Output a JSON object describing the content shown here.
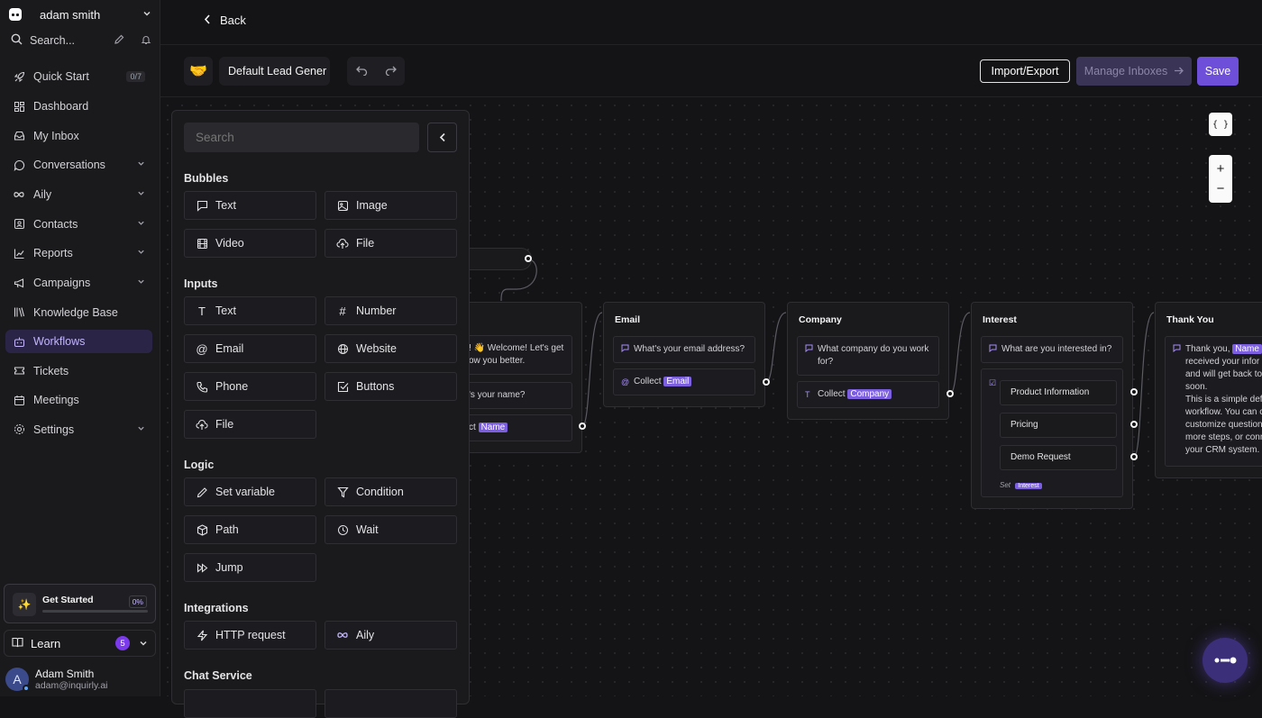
{
  "sidebar": {
    "workspace": "adam smith",
    "search_label": "Search...",
    "items": [
      {
        "label": "Quick Start",
        "badge": "0/7"
      },
      {
        "label": "Dashboard"
      },
      {
        "label": "My Inbox"
      },
      {
        "label": "Conversations"
      },
      {
        "label": "Aily"
      },
      {
        "label": "Contacts"
      },
      {
        "label": "Reports"
      },
      {
        "label": "Campaigns"
      },
      {
        "label": "Knowledge Base"
      },
      {
        "label": "Workflows"
      },
      {
        "label": "Tickets"
      },
      {
        "label": "Meetings"
      },
      {
        "label": "Settings"
      }
    ],
    "get_started": {
      "label": "Get Started",
      "progress": "0%"
    },
    "learn": {
      "label": "Learn",
      "count": "5"
    },
    "user": {
      "initial": "A",
      "name": "Adam Smith",
      "email": "adam@inquirly.ai"
    }
  },
  "topbar": {
    "back_label": "Back"
  },
  "toolbar": {
    "emoji": "🤝",
    "workflow_name": "Default Lead Gener",
    "import_export": "Import/Export",
    "manage_inboxes": "Manage Inboxes",
    "save": "Save"
  },
  "panel": {
    "search_placeholder": "Search",
    "sections": {
      "bubbles": "Bubbles",
      "inputs": "Inputs",
      "logic": "Logic",
      "integrations": "Integrations",
      "chat_service": "Chat Service"
    },
    "bubbles": [
      "Text",
      "Image",
      "Video",
      "File"
    ],
    "inputs": [
      "Text",
      "Number",
      "Email",
      "Website",
      "Phone",
      "Buttons",
      "File"
    ],
    "logic": [
      "Set variable",
      "Condition",
      "Path",
      "Wait",
      "Jump"
    ],
    "integrations": [
      "HTTP request",
      "Aily"
    ]
  },
  "canvas": {
    "controls": {
      "vars": "{ }",
      "zoom_in": "+",
      "zoom_out": "−"
    },
    "nodes": {
      "name": {
        "welcome": "! 👋 Welcome! Let's get",
        "welcome2": "ow you better.",
        "question": "'s your name?",
        "collect": "ct",
        "var": "Name"
      },
      "email": {
        "title": "Email",
        "question": "What's your email address?",
        "collect": "Collect",
        "var": "Email"
      },
      "company": {
        "title": "Company",
        "question": "What company do you work for?",
        "collect": "Collect",
        "var": "Company"
      },
      "interest": {
        "title": "Interest",
        "question": "What are you interested in?",
        "options": [
          "Product Information",
          "Pricing",
          "Demo Request"
        ],
        "set_label": "Set",
        "var": "Interest"
      },
      "thankyou": {
        "title": "Thank You",
        "lines": [
          "Thank you,",
          "received your infor",
          "and will get back to",
          "soon.",
          "This is a simple defa",
          "workflow. You can c",
          "customize question",
          "more steps, or conn",
          "your CRM system."
        ],
        "var": "Name"
      }
    }
  }
}
